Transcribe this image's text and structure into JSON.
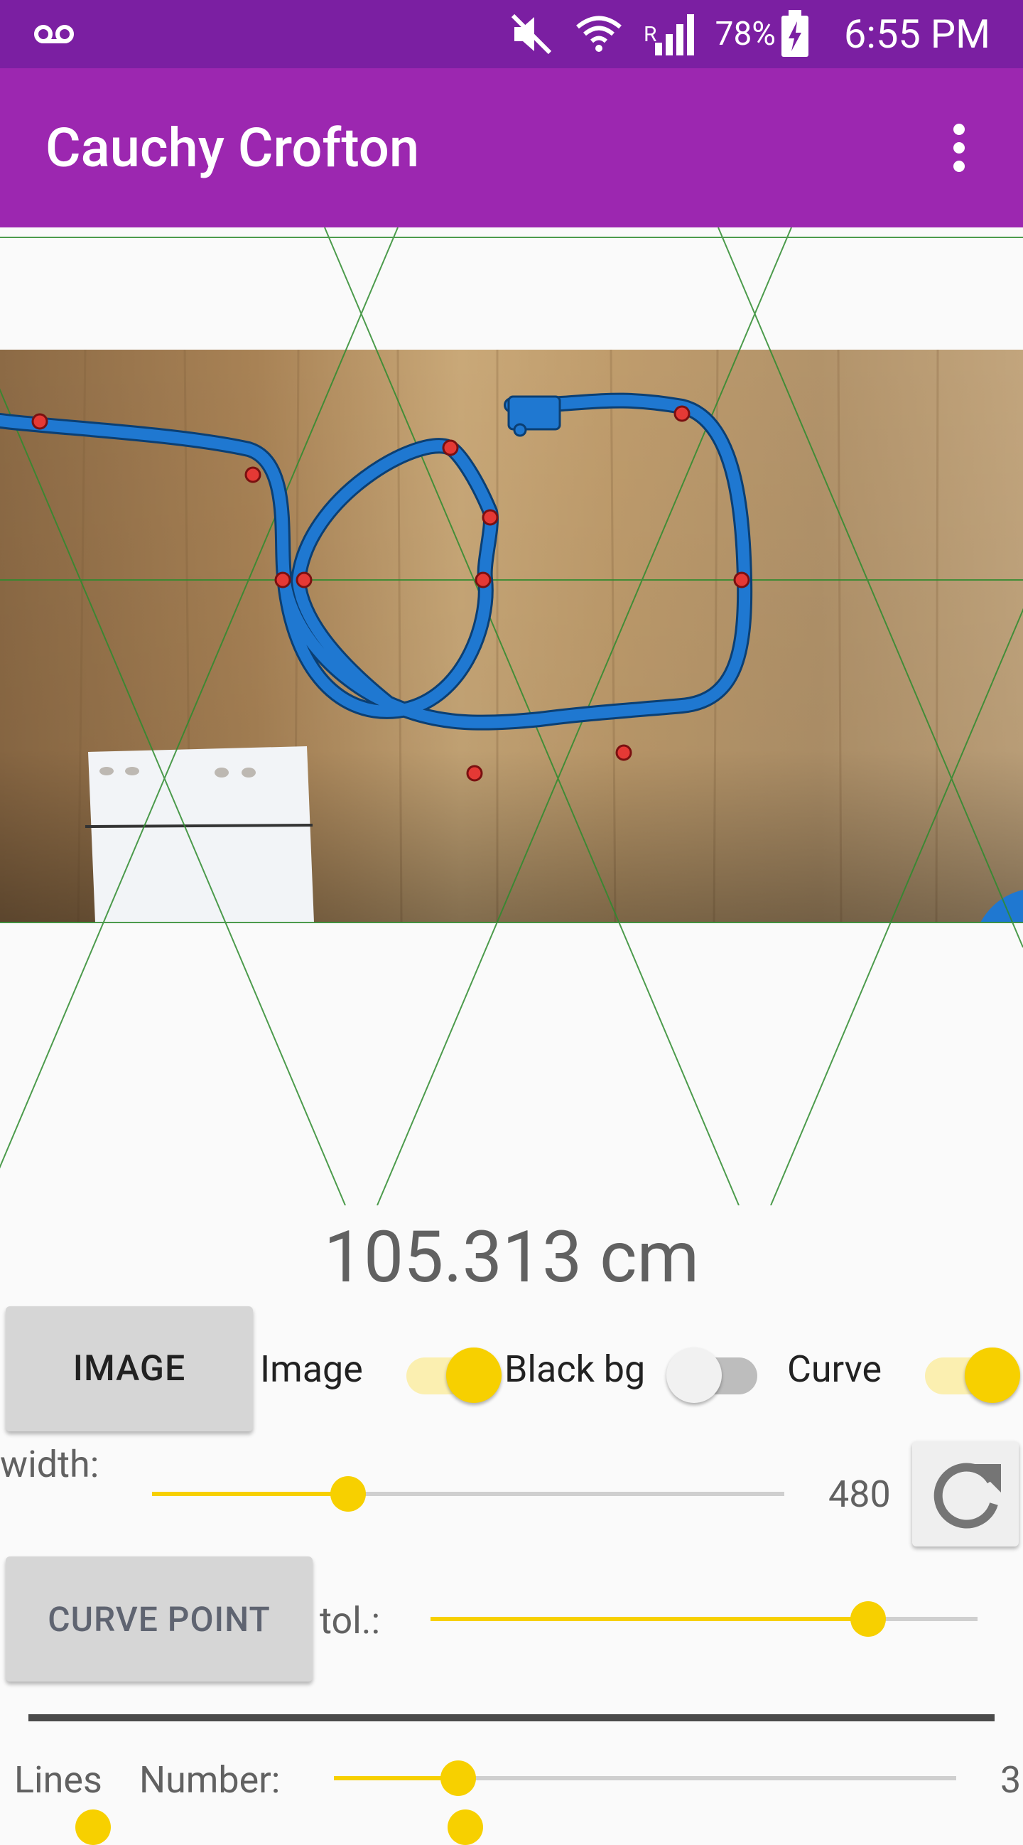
{
  "status_bar": {
    "battery_percent": "78%",
    "time": "6:55 PM",
    "network_indicator": "R",
    "icons": [
      "voicemail-icon",
      "mute-icon",
      "wifi-icon",
      "signal-icon",
      "battery-charging-icon"
    ]
  },
  "app_bar": {
    "title": "Cauchy Crofton",
    "menu_icon": "overflow-menu-icon"
  },
  "measurement": "105.313 cm",
  "controls": {
    "image_button": "IMAGE",
    "image_switch_label": "Image",
    "image_switch_on": true,
    "black_bg_label": "Black bg",
    "black_bg_on": false,
    "curve_label": "Curve",
    "curve_on": true,
    "width_label": "width:",
    "width_value": "480",
    "width_level": 0.31,
    "refresh_icon": "refresh-icon",
    "curve_point_button": "CURVE POINT",
    "tol_label": "tol.:",
    "tol_level": 0.8,
    "lines_label": "Lines",
    "number_label": "Number:",
    "number_level": 0.2,
    "number_value": "3"
  },
  "colors": {
    "status_bar": "#7b1fa2",
    "app_bar": "#9c27b0",
    "accent": "#f7d000",
    "curve": "#1f78d1",
    "grid_lines": "#2e8b2e",
    "intersection_points": "#e53935"
  }
}
